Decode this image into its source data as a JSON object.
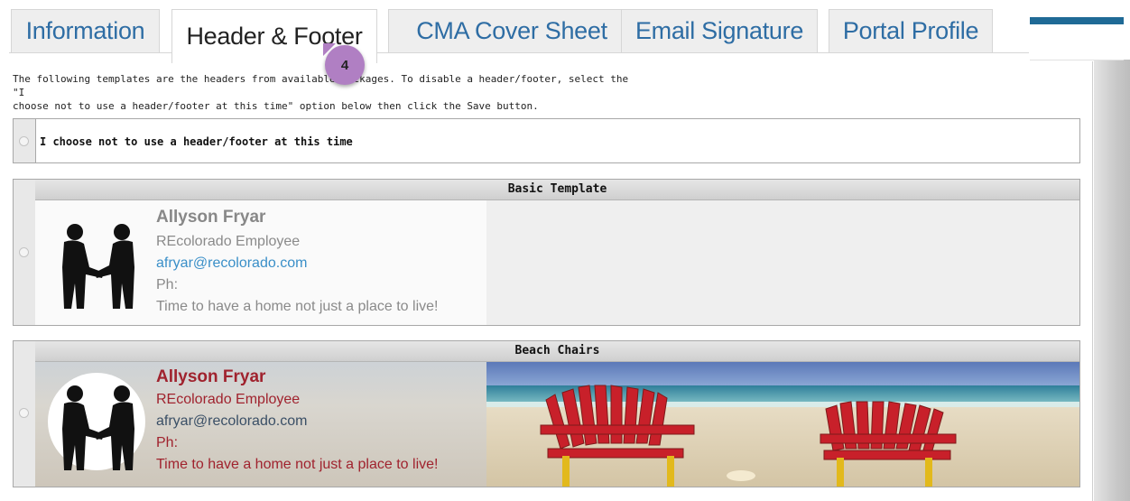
{
  "tabs": [
    {
      "label": "Information"
    },
    {
      "label": "Header & Footer"
    },
    {
      "label": "CMA Cover Sheet"
    },
    {
      "label": "Email Signature"
    },
    {
      "label": "Portal Profile"
    }
  ],
  "step_marker": "4",
  "intro": {
    "line1": "The following templates are the headers from available packages. To disable a header/footer, select the \"I",
    "line2": "choose not to use a header/footer at this time\" option below then click the Save button."
  },
  "opt_out_label": "I choose not to use a header/footer at this time",
  "templates": [
    {
      "title": "Basic Template",
      "name": "Allyson Fryar",
      "role": "REcolorado Employee",
      "email": "afryar@recolorado.com",
      "phone": "Ph:",
      "tagline": "Time to have a home not just a place to live!"
    },
    {
      "title": "Beach Chairs",
      "name": "Allyson Fryar",
      "role": "REcolorado Employee",
      "email": "afryar@recolorado.com",
      "phone": "Ph:",
      "tagline": "Time to have a home not just a place to live!"
    }
  ],
  "colors": {
    "tab_text": "#2e6da4",
    "active_tab_text": "#222222",
    "basic_name": "#888888",
    "basic_text": "#8a8a8a",
    "email_blue": "#3a8fc8",
    "beach_red": "#a0232e",
    "marker": "#b07fc3",
    "accent_bar": "#1f6a96"
  }
}
